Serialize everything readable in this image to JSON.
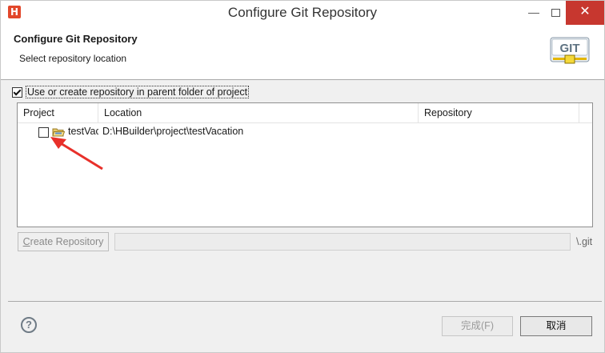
{
  "window": {
    "title": "Configure Git Repository",
    "app_icon": "H",
    "minimize_glyph": "—",
    "close_glyph": "✕"
  },
  "banner": {
    "title": "Configure Git Repository",
    "subtitle": "Select repository location",
    "logo_text": "GIT"
  },
  "parent_option": {
    "label": "Use or create repository in parent folder of project",
    "checked": true
  },
  "table": {
    "columns": [
      "Project",
      "Location",
      "Repository"
    ],
    "rows": [
      {
        "project": "testVacation",
        "location": "D:\\HBuilder\\project\\testVacation",
        "repository": "",
        "checked": false
      }
    ]
  },
  "create": {
    "button_mnemonic": "C",
    "button_rest": "reate Repository",
    "path_value": "",
    "suffix": "\\.git"
  },
  "footer": {
    "help_glyph": "?",
    "finish_label": "完成(F)",
    "cancel_label": "取消"
  },
  "colors": {
    "close_button": "#c7372f",
    "app_icon": "#e2472b",
    "annotation_arrow": "#e8302a"
  }
}
